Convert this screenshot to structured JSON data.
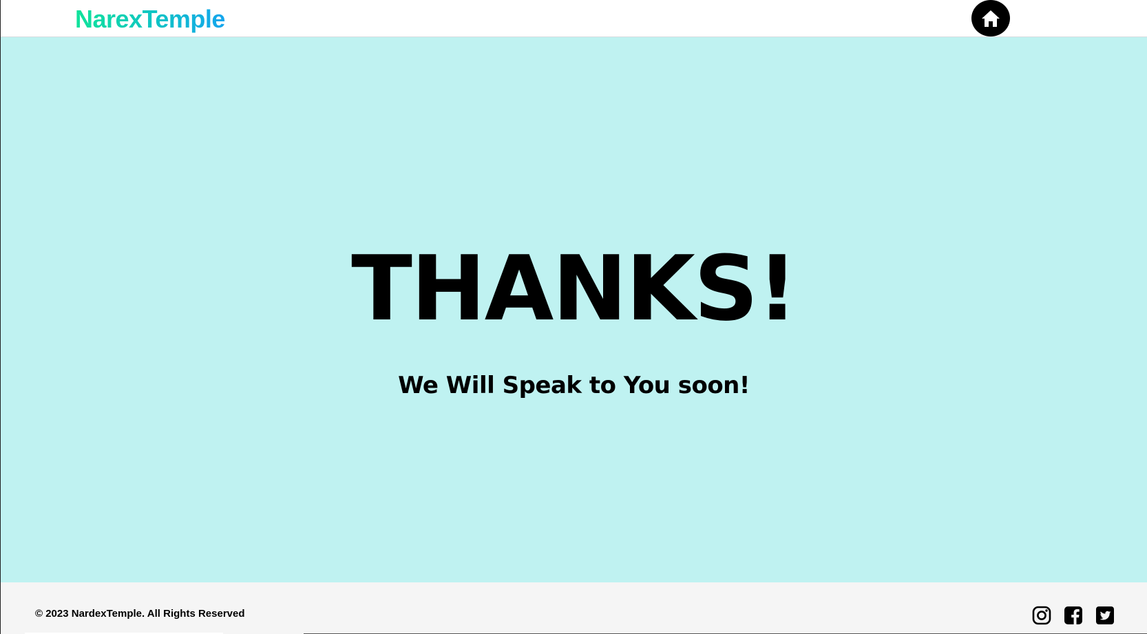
{
  "header": {
    "logo_text": "NarexTemple",
    "home_icon": "home-icon"
  },
  "main": {
    "heading": "THANKS!",
    "subheading": "We Will Speak to You soon!"
  },
  "footer": {
    "copyright": "© 2023 NardexTemple. All Rights Reserved",
    "social_icons": [
      "instagram-icon",
      "facebook-icon",
      "twitter-icon"
    ]
  },
  "colors": {
    "main_background": "#bff2f1",
    "footer_background": "#f5f5f5",
    "logo_gradient_start": "#10e39a",
    "logo_gradient_end": "#14a5ee",
    "text": "#000000"
  }
}
